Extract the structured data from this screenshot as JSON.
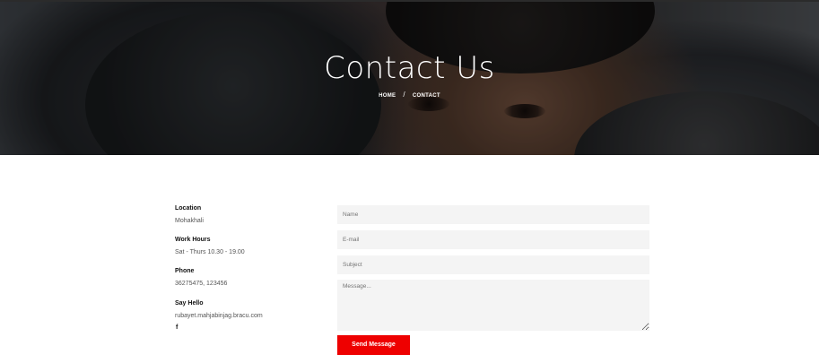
{
  "hero": {
    "title": "Contact Us",
    "breadcrumb": {
      "home": "HOME",
      "separator": "/",
      "current": "CONTACT"
    }
  },
  "contact_info": [
    {
      "heading": "Location",
      "value": "Mohakhali"
    },
    {
      "heading": "Work Hours",
      "value": "Sat - Thurs 10.30 - 19.00"
    },
    {
      "heading": "Phone",
      "value": "36275475, 123456"
    },
    {
      "heading": "Say Hello",
      "value": "rubayet.mahjabinjag.bracu.com"
    }
  ],
  "social": {
    "facebook_glyph": "f",
    "icon": "facebook-icon"
  },
  "form": {
    "name_placeholder": "Name",
    "email_placeholder": "E-mail",
    "subject_placeholder": "Subject",
    "message_placeholder": "Message...",
    "submit_label": "Send Message"
  },
  "colors": {
    "accent": "#ee0000",
    "field_bg": "#f4f4f4"
  }
}
